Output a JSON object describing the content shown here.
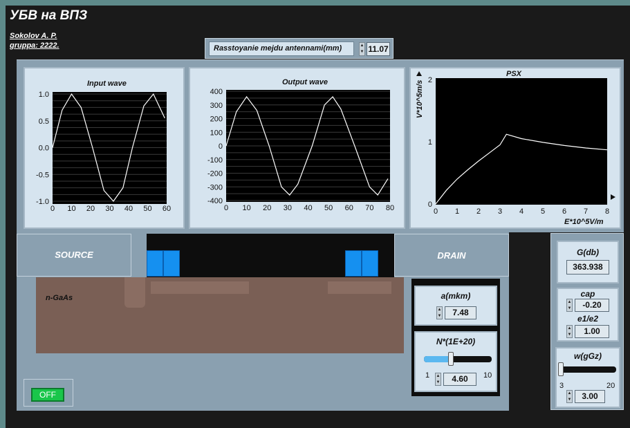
{
  "app": {
    "title": "УБВ на ВПЗ"
  },
  "author": {
    "line1": "Sokolov A. P.",
    "line2": "gruppa: 2222."
  },
  "distance": {
    "label": "Rasstoyanie mejdu antennami(mm)",
    "value": "11.07"
  },
  "charts": {
    "input": {
      "title": "Input wave",
      "yticks": [
        "1.0",
        "0.5",
        "0.0",
        "-0.5",
        "-1.0"
      ],
      "xticks": [
        "0",
        "10",
        "20",
        "30",
        "40",
        "50",
        "60"
      ]
    },
    "output": {
      "title": "Output wave",
      "yticks": [
        "400",
        "300",
        "200",
        "100",
        "0",
        "-100",
        "-200",
        "-300",
        "-400"
      ],
      "xticks": [
        "0",
        "10",
        "20",
        "30",
        "40",
        "50",
        "60",
        "70",
        "80"
      ]
    },
    "psx": {
      "title": "PSX",
      "ylabel": "V*10^5m/s",
      "xlabel": "E*10^5V/m",
      "yticks": [
        "2",
        "1",
        "0"
      ],
      "xticks": [
        "0",
        "1",
        "2",
        "3",
        "4",
        "5",
        "6",
        "7",
        "8"
      ]
    }
  },
  "chart_data": [
    {
      "type": "line",
      "title": "Input wave",
      "xlim": [
        0,
        60
      ],
      "ylim": [
        -1,
        1
      ],
      "series": [
        {
          "x": [
            0,
            5,
            10,
            15,
            21,
            27,
            32,
            37,
            42,
            48,
            53,
            57,
            59
          ],
          "y": [
            0,
            0.7,
            1.0,
            0.75,
            0,
            -0.8,
            -1.0,
            -0.75,
            0,
            0.78,
            1.0,
            0.7,
            0.55
          ]
        }
      ]
    },
    {
      "type": "line",
      "title": "Output wave",
      "xlim": [
        0,
        80
      ],
      "ylim": [
        -400,
        400
      ],
      "series": [
        {
          "x": [
            0,
            5,
            10,
            15,
            21,
            27,
            31,
            35,
            42,
            48,
            52,
            56,
            63,
            70,
            74,
            79
          ],
          "y": [
            0,
            250,
            360,
            260,
            0,
            -300,
            -360,
            -280,
            0,
            300,
            360,
            270,
            -10,
            -300,
            -360,
            -240
          ]
        }
      ]
    },
    {
      "type": "line",
      "title": "PSX",
      "xlabel": "E*10^5V/m",
      "ylabel": "V*10^5m/s",
      "xlim": [
        0,
        8
      ],
      "ylim": [
        0,
        2
      ],
      "series": [
        {
          "x": [
            0,
            0.5,
            1,
            1.5,
            2,
            2.5,
            3,
            3.3,
            4,
            5,
            6,
            7,
            8
          ],
          "y": [
            0,
            0.22,
            0.4,
            0.55,
            0.69,
            0.82,
            0.95,
            1.12,
            1.05,
            0.99,
            0.94,
            0.9,
            0.87
          ]
        }
      ]
    }
  ],
  "device": {
    "source": "SOURCE",
    "drain": "DRAIN",
    "substrate": "n-GaAs"
  },
  "params": {
    "a": {
      "label": "a(mkm)",
      "value": "7.48"
    },
    "n": {
      "label": "N*(1E+20)",
      "value": "4.60",
      "min": "1",
      "max": "10",
      "level": 0.4
    },
    "g": {
      "label": "G(db)",
      "value": "363.938"
    },
    "cap": {
      "label": "cap",
      "value": "-0.20"
    },
    "e": {
      "label": "e1/e2",
      "value": "1.00"
    },
    "w": {
      "label": "w(gGz)",
      "value": "3.00",
      "min": "3",
      "max": "20",
      "level": 0.0
    }
  },
  "power": {
    "label": "OFF"
  }
}
